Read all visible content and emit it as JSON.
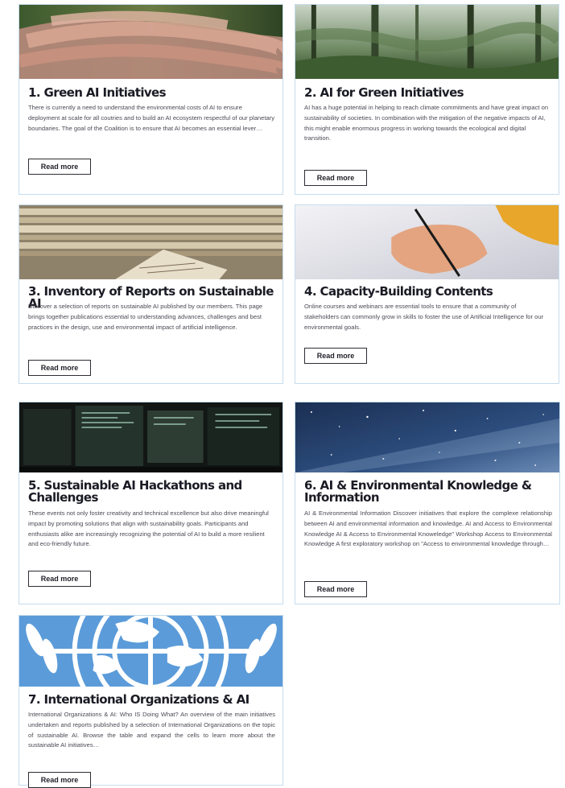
{
  "colors": {
    "card_border": "#c6dced",
    "title": "#1b1b25",
    "body_text": "#4a4a55",
    "button_border": "#2d2d35",
    "un_blue": "#5b9bd9"
  },
  "cards": [
    {
      "title": "1. Green AI Initiatives",
      "text": "There is currently a need to understand the environmental costs of AI to ensure deployment at scale for all coutries and to build an AI ecosystem respectful of our planetary boundaries. The goal of the Coalition is to ensure that AI becomes an essential lever…",
      "button": "Read more",
      "image": "hands-together-photo"
    },
    {
      "title": "2. AI for Green Initiatives",
      "text": "AI has a huge potential in helping to reach climate commitments and have great impact on sustainability of societies. In combination with the mitigation of the negative impacts of AI, this might enable enormous progress in working towards the ecological and digital transition.",
      "button": "Read more",
      "image": "misty-forest-photo"
    },
    {
      "title": "3. Inventory of Reports on Sustainable AI",
      "text": "Discover a selection of reports on sustainable AI published by our members. This page brings together publications essential to understanding advances, challenges and best practices in the design, use and environmental impact of artificial intelligence.",
      "button": "Read more",
      "image": "paper-stack-photo"
    },
    {
      "title": "4. Capacity-Building Contents",
      "text": "Online courses and webinars are essential tools to ensure that a community of stakeholders can commonly grow in skills to foster the use of Artificial Intelligence for our environmental goals.",
      "button": "Read more",
      "image": "hand-writing-photo"
    },
    {
      "title": "5. Sustainable AI Hackathons and Challenges",
      "text": "These events not only foster creativity and technical excellence but also drive meaningful impact by promoting solutions that align with sustainability goals. Participants and enthusiasts alike are increasingly recognizing the potential of AI to build a more resilient and eco-friendly future.",
      "button": "Read more",
      "image": "code-screens-photo"
    },
    {
      "title": "6. AI & Environmental Knowledge & Information",
      "text": "AI & Environmental Information Discover initiatives that explore the complexe relationship between AI and environmental information and knowledge. AI and Access to Environmental Knowledge AI & Access to Environmental Knoweledge\" Workshop Access to Environmental Knowledge A first exploratory workshop on \"Access to environmental knowledge through…",
      "button": "Read more",
      "image": "starry-sky-photo"
    },
    {
      "title": "7. International Organizations & AI",
      "text": "International Organizations & AI: Who IS Doing What? An overview of the main initiatives undertaken and reports published by a selection of International Organizations on the topic of sustainable AI. Browse the table and expand the cells to learn more about the sustainable AI initiatives…",
      "button": "Read more",
      "image": "un-emblem"
    }
  ]
}
